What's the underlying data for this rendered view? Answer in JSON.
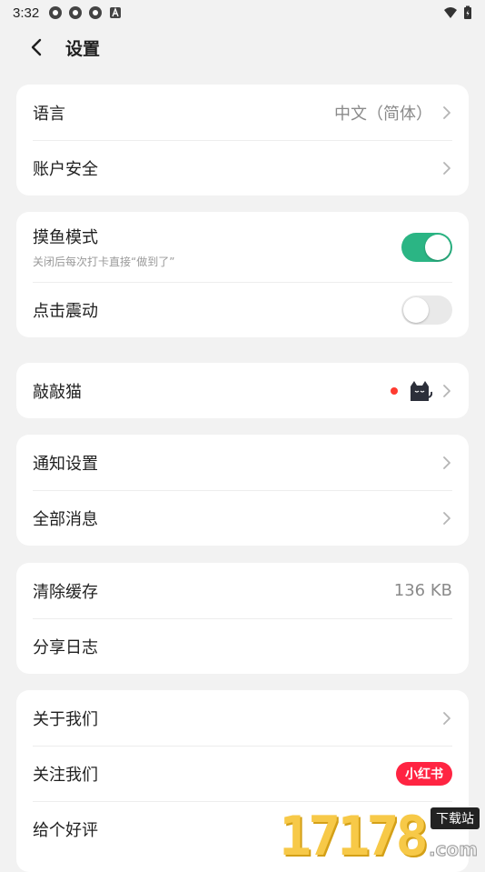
{
  "status_bar": {
    "time": "3:32",
    "left_icons": [
      "app-notification-icon",
      "app-notification-icon",
      "app-notification-icon",
      "a-box-icon"
    ],
    "right_icons": [
      "wifi-icon",
      "battery-icon"
    ]
  },
  "header": {
    "title": "设置"
  },
  "groups": {
    "general": {
      "language_label": "语言",
      "language_value": "中文（简体）",
      "account_label": "账户安全"
    },
    "mode": {
      "slack_label": "摸鱼模式",
      "slack_sub": "关闭后每次打卡直接“做到了”",
      "slack_enabled": true,
      "vibration_label": "点击震动",
      "vibration_enabled": false
    },
    "cat": {
      "label": "敲敲猫"
    },
    "notify": {
      "settings_label": "通知设置",
      "all_messages_label": "全部消息"
    },
    "storage": {
      "clear_cache_label": "清除缓存",
      "cache_size": "136 KB",
      "share_log_label": "分享日志"
    },
    "about": {
      "about_label": "关于我们",
      "follow_label": "关注我们",
      "follow_badge": "小红书",
      "rate_label": "给个好评"
    }
  },
  "watermark": {
    "number": "17178",
    "tag": "下载站",
    "suffix": ".com"
  },
  "colors": {
    "accent": "#2bb584",
    "background": "#f2f2f2",
    "badge_red": "#ff2442",
    "dot_red": "#ff3b30"
  }
}
